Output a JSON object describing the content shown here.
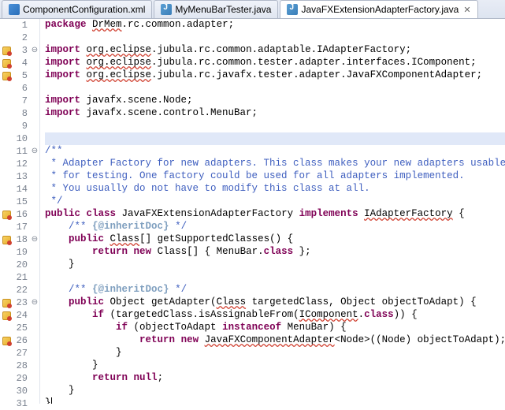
{
  "tabs": [
    {
      "label": "ComponentConfiguration.xml",
      "icon": "xml",
      "active": false
    },
    {
      "label": "MyMenuBarTester.java",
      "icon": "java",
      "active": false
    },
    {
      "label": "JavaFXExtensionAdapterFactory.java",
      "icon": "java",
      "active": true
    }
  ],
  "lines": [
    {
      "n": "1",
      "m": "",
      "f": "",
      "hl": false,
      "segs": [
        [
          "kw",
          "package"
        ],
        [
          "blk",
          " "
        ],
        [
          "err",
          "DrMem"
        ],
        [
          "blk",
          ".rc.common.adapter;"
        ]
      ]
    },
    {
      "n": "2",
      "m": "",
      "f": "",
      "hl": false,
      "segs": []
    },
    {
      "n": "3",
      "m": "err",
      "f": "⊖",
      "hl": false,
      "segs": [
        [
          "kw",
          "import"
        ],
        [
          "blk",
          " "
        ],
        [
          "err",
          "org.eclipse"
        ],
        [
          "blk",
          ".jubula.rc.common.adaptable.IAdapterFactory;"
        ]
      ]
    },
    {
      "n": "4",
      "m": "err",
      "f": "",
      "hl": false,
      "segs": [
        [
          "kw",
          "import"
        ],
        [
          "blk",
          " "
        ],
        [
          "err",
          "org.eclipse"
        ],
        [
          "blk",
          ".jubula.rc.common.tester.adapter.interfaces.IComponent;"
        ]
      ]
    },
    {
      "n": "5",
      "m": "err",
      "f": "",
      "hl": false,
      "segs": [
        [
          "kw",
          "import"
        ],
        [
          "blk",
          " "
        ],
        [
          "err",
          "org.eclipse"
        ],
        [
          "blk",
          ".jubula.rc.javafx.tester.adapter.JavaFXComponentAdapter;"
        ]
      ]
    },
    {
      "n": "6",
      "m": "",
      "f": "",
      "hl": false,
      "segs": []
    },
    {
      "n": "7",
      "m": "",
      "f": "",
      "hl": false,
      "segs": [
        [
          "kw",
          "import"
        ],
        [
          "blk",
          " javafx.scene.Node;"
        ]
      ]
    },
    {
      "n": "8",
      "m": "",
      "f": "",
      "hl": false,
      "segs": [
        [
          "kw",
          "import"
        ],
        [
          "blk",
          " javafx.scene.control.MenuBar;"
        ]
      ]
    },
    {
      "n": "9",
      "m": "",
      "f": "",
      "hl": false,
      "segs": []
    },
    {
      "n": "10",
      "m": "",
      "f": "",
      "hl": true,
      "segs": []
    },
    {
      "n": "11",
      "m": "",
      "f": "⊖",
      "hl": false,
      "segs": [
        [
          "cm",
          "/**"
        ]
      ]
    },
    {
      "n": "12",
      "m": "",
      "f": "",
      "hl": false,
      "segs": [
        [
          "cm",
          " * Adapter Factory for new adapters. This class makes your new adapters usable"
        ]
      ]
    },
    {
      "n": "13",
      "m": "",
      "f": "",
      "hl": false,
      "segs": [
        [
          "cm",
          " * for testing. One factory could be used for all adapters implemented."
        ]
      ]
    },
    {
      "n": "14",
      "m": "",
      "f": "",
      "hl": false,
      "segs": [
        [
          "cm",
          " * You usually do not have to modify this class at all."
        ]
      ]
    },
    {
      "n": "15",
      "m": "",
      "f": "",
      "hl": false,
      "segs": [
        [
          "cm",
          " */"
        ]
      ]
    },
    {
      "n": "16",
      "m": "err",
      "f": "",
      "hl": false,
      "segs": [
        [
          "kw",
          "public"
        ],
        [
          "blk",
          " "
        ],
        [
          "kw",
          "class"
        ],
        [
          "blk",
          " JavaFXExtensionAdapterFactory "
        ],
        [
          "kw",
          "implements"
        ],
        [
          "blk",
          " "
        ],
        [
          "err",
          "IAdapterFactory"
        ],
        [
          "blk",
          " {"
        ]
      ]
    },
    {
      "n": "17",
      "m": "",
      "f": "",
      "hl": false,
      "segs": [
        [
          "blk",
          "    "
        ],
        [
          "cm",
          "/** "
        ],
        [
          "tag",
          "{@inheritDoc}"
        ],
        [
          "cm",
          " */"
        ]
      ]
    },
    {
      "n": "18",
      "m": "err",
      "f": "⊖",
      "hl": false,
      "segs": [
        [
          "blk",
          "    "
        ],
        [
          "kw",
          "public"
        ],
        [
          "blk",
          " "
        ],
        [
          "err",
          "Class"
        ],
        [
          "blk",
          "[] getSupportedClasses() {"
        ]
      ]
    },
    {
      "n": "19",
      "m": "",
      "f": "",
      "hl": false,
      "segs": [
        [
          "blk",
          "        "
        ],
        [
          "kw",
          "return"
        ],
        [
          "blk",
          " "
        ],
        [
          "kw",
          "new"
        ],
        [
          "blk",
          " Class[] { MenuBar."
        ],
        [
          "kw",
          "class"
        ],
        [
          "blk",
          " };"
        ]
      ]
    },
    {
      "n": "20",
      "m": "",
      "f": "",
      "hl": false,
      "segs": [
        [
          "blk",
          "    }"
        ]
      ]
    },
    {
      "n": "21",
      "m": "",
      "f": "",
      "hl": false,
      "segs": []
    },
    {
      "n": "22",
      "m": "",
      "f": "",
      "hl": false,
      "segs": [
        [
          "blk",
          "    "
        ],
        [
          "cm",
          "/** "
        ],
        [
          "tag",
          "{@inheritDoc}"
        ],
        [
          "cm",
          " */"
        ]
      ]
    },
    {
      "n": "23",
      "m": "err",
      "f": "⊖",
      "hl": false,
      "segs": [
        [
          "blk",
          "    "
        ],
        [
          "kw",
          "public"
        ],
        [
          "blk",
          " Object getAdapter("
        ],
        [
          "err",
          "Class"
        ],
        [
          "blk",
          " targetedClass, Object objectToAdapt) {"
        ]
      ]
    },
    {
      "n": "24",
      "m": "err",
      "f": "",
      "hl": false,
      "segs": [
        [
          "blk",
          "        "
        ],
        [
          "kw",
          "if"
        ],
        [
          "blk",
          " (targetedClass.isAssignableFrom("
        ],
        [
          "err",
          "IComponent"
        ],
        [
          "blk",
          "."
        ],
        [
          "kw",
          "class"
        ],
        [
          "blk",
          ")) {"
        ]
      ]
    },
    {
      "n": "25",
      "m": "",
      "f": "",
      "hl": false,
      "segs": [
        [
          "blk",
          "            "
        ],
        [
          "kw",
          "if"
        ],
        [
          "blk",
          " (objectToAdapt "
        ],
        [
          "kw",
          "instanceof"
        ],
        [
          "blk",
          " MenuBar) {"
        ]
      ]
    },
    {
      "n": "26",
      "m": "err",
      "f": "",
      "hl": false,
      "segs": [
        [
          "blk",
          "                "
        ],
        [
          "kw",
          "return"
        ],
        [
          "blk",
          " "
        ],
        [
          "kw",
          "new"
        ],
        [
          "blk",
          " "
        ],
        [
          "err",
          "JavaFXComponentAdapter"
        ],
        [
          "blk",
          "<Node>((Node) objectToAdapt);"
        ]
      ]
    },
    {
      "n": "27",
      "m": "",
      "f": "",
      "hl": false,
      "segs": [
        [
          "blk",
          "            }"
        ]
      ]
    },
    {
      "n": "28",
      "m": "",
      "f": "",
      "hl": false,
      "segs": [
        [
          "blk",
          "        }"
        ]
      ]
    },
    {
      "n": "29",
      "m": "",
      "f": "",
      "hl": false,
      "segs": [
        [
          "blk",
          "        "
        ],
        [
          "kw",
          "return"
        ],
        [
          "blk",
          " "
        ],
        [
          "kw",
          "null"
        ],
        [
          "blk",
          ";"
        ]
      ]
    },
    {
      "n": "30",
      "m": "",
      "f": "",
      "hl": false,
      "segs": [
        [
          "blk",
          "    }"
        ]
      ]
    },
    {
      "n": "31",
      "m": "",
      "f": "",
      "hl": false,
      "segs": [
        [
          "blk",
          "}"
        ],
        [
          "cursor",
          ""
        ]
      ]
    }
  ]
}
